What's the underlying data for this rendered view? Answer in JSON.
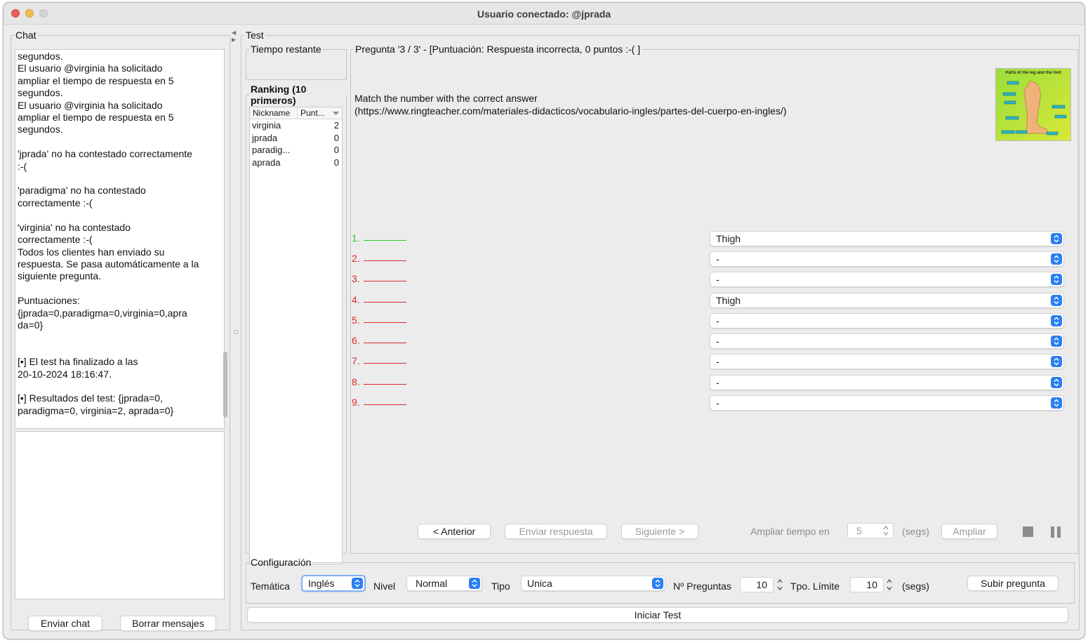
{
  "window": {
    "title": "Usuario conectado: @jprada"
  },
  "colors": {
    "correct": "#2fcb2f",
    "incorrect": "#dd2a2a",
    "accent": "#2a7ff5"
  },
  "chat": {
    "legend": "Chat",
    "log": "segundos.\nEl usuario @virginia ha solicitado\nampliar el tiempo de respuesta en 5\nsegundos.\nEl usuario @virginia ha solicitado\nampliar el tiempo de respuesta en 5\nsegundos.\n\n'jprada' no ha contestado correctamente\n:-(\n\n'paradigma' no ha contestado\ncorrectamente :-(\n\n'virginia' no ha contestado\ncorrectamente :-(\nTodos los clientes han enviado su\nrespuesta. Se pasa automáticamente a la\nsiguiente pregunta.\n\nPuntuaciones:\n{jprada=0,paradigma=0,virginia=0,apra\nda=0}\n\n\n[•] El test ha finalizado a las\n20-10-2024 18:16:47.\n\n[•] Resultados del test: {jprada=0,\nparadigma=0, virginia=2, aprada=0}",
    "send_label": "Enviar chat",
    "clear_label": "Borrar mensajes"
  },
  "test": {
    "legend": "Test",
    "time_legend": "Tiempo restante",
    "ranking": {
      "legend": "Ranking (10 primeros)",
      "col_nick": "Nickname",
      "col_points": "Punt...",
      "rows": [
        {
          "nick": "virginia",
          "points": "2"
        },
        {
          "nick": "jprada",
          "points": "0"
        },
        {
          "nick": "paradig...",
          "points": "0"
        },
        {
          "nick": "aprada",
          "points": "0"
        }
      ]
    },
    "question": {
      "legend": "Pregunta '3 / 3' - [Puntuación: Respuesta incorrecta, 0 puntos :-( ]",
      "text": "Match the number with the correct answer\n(https://www.ringteacher.com/materiales-didacticos/vocabulario-ingles/partes-del-cuerpo-en-ingles/)",
      "image_title": "Parts of the leg and the foot",
      "answers": [
        {
          "num": "1.",
          "selected": "Thigh",
          "correct": true
        },
        {
          "num": "2.",
          "selected": "-",
          "correct": false
        },
        {
          "num": "3.",
          "selected": "-",
          "correct": false
        },
        {
          "num": "4.",
          "selected": "Thigh",
          "correct": false
        },
        {
          "num": "5.",
          "selected": "-",
          "correct": false
        },
        {
          "num": "6.",
          "selected": "-",
          "correct": false
        },
        {
          "num": "7.",
          "selected": "-",
          "correct": false
        },
        {
          "num": "8.",
          "selected": "-",
          "correct": false
        },
        {
          "num": "9.",
          "selected": "-",
          "correct": false
        }
      ]
    },
    "controls": {
      "prev": "< Anterior",
      "send": "Enviar respuesta",
      "next": "Siguiente >",
      "extend_label": "Ampliar tiempo en",
      "extend_value": "5",
      "segs": "(segs)",
      "extend_button": "Ampliar"
    },
    "config": {
      "legend": "Configuración",
      "topic_label": "Temática",
      "topic_value": "Inglés",
      "level_label": "Nivel",
      "level_value": "Normal",
      "type_label": "Tipo",
      "type_value": "Unica",
      "num_questions_label": "Nº Preguntas",
      "num_questions_value": "10",
      "time_limit_label": "Tpo. Límite",
      "time_limit_value": "10",
      "segs": "(segs)",
      "upload_label": "Subir pregunta"
    },
    "start_label": "Iniciar Test"
  }
}
